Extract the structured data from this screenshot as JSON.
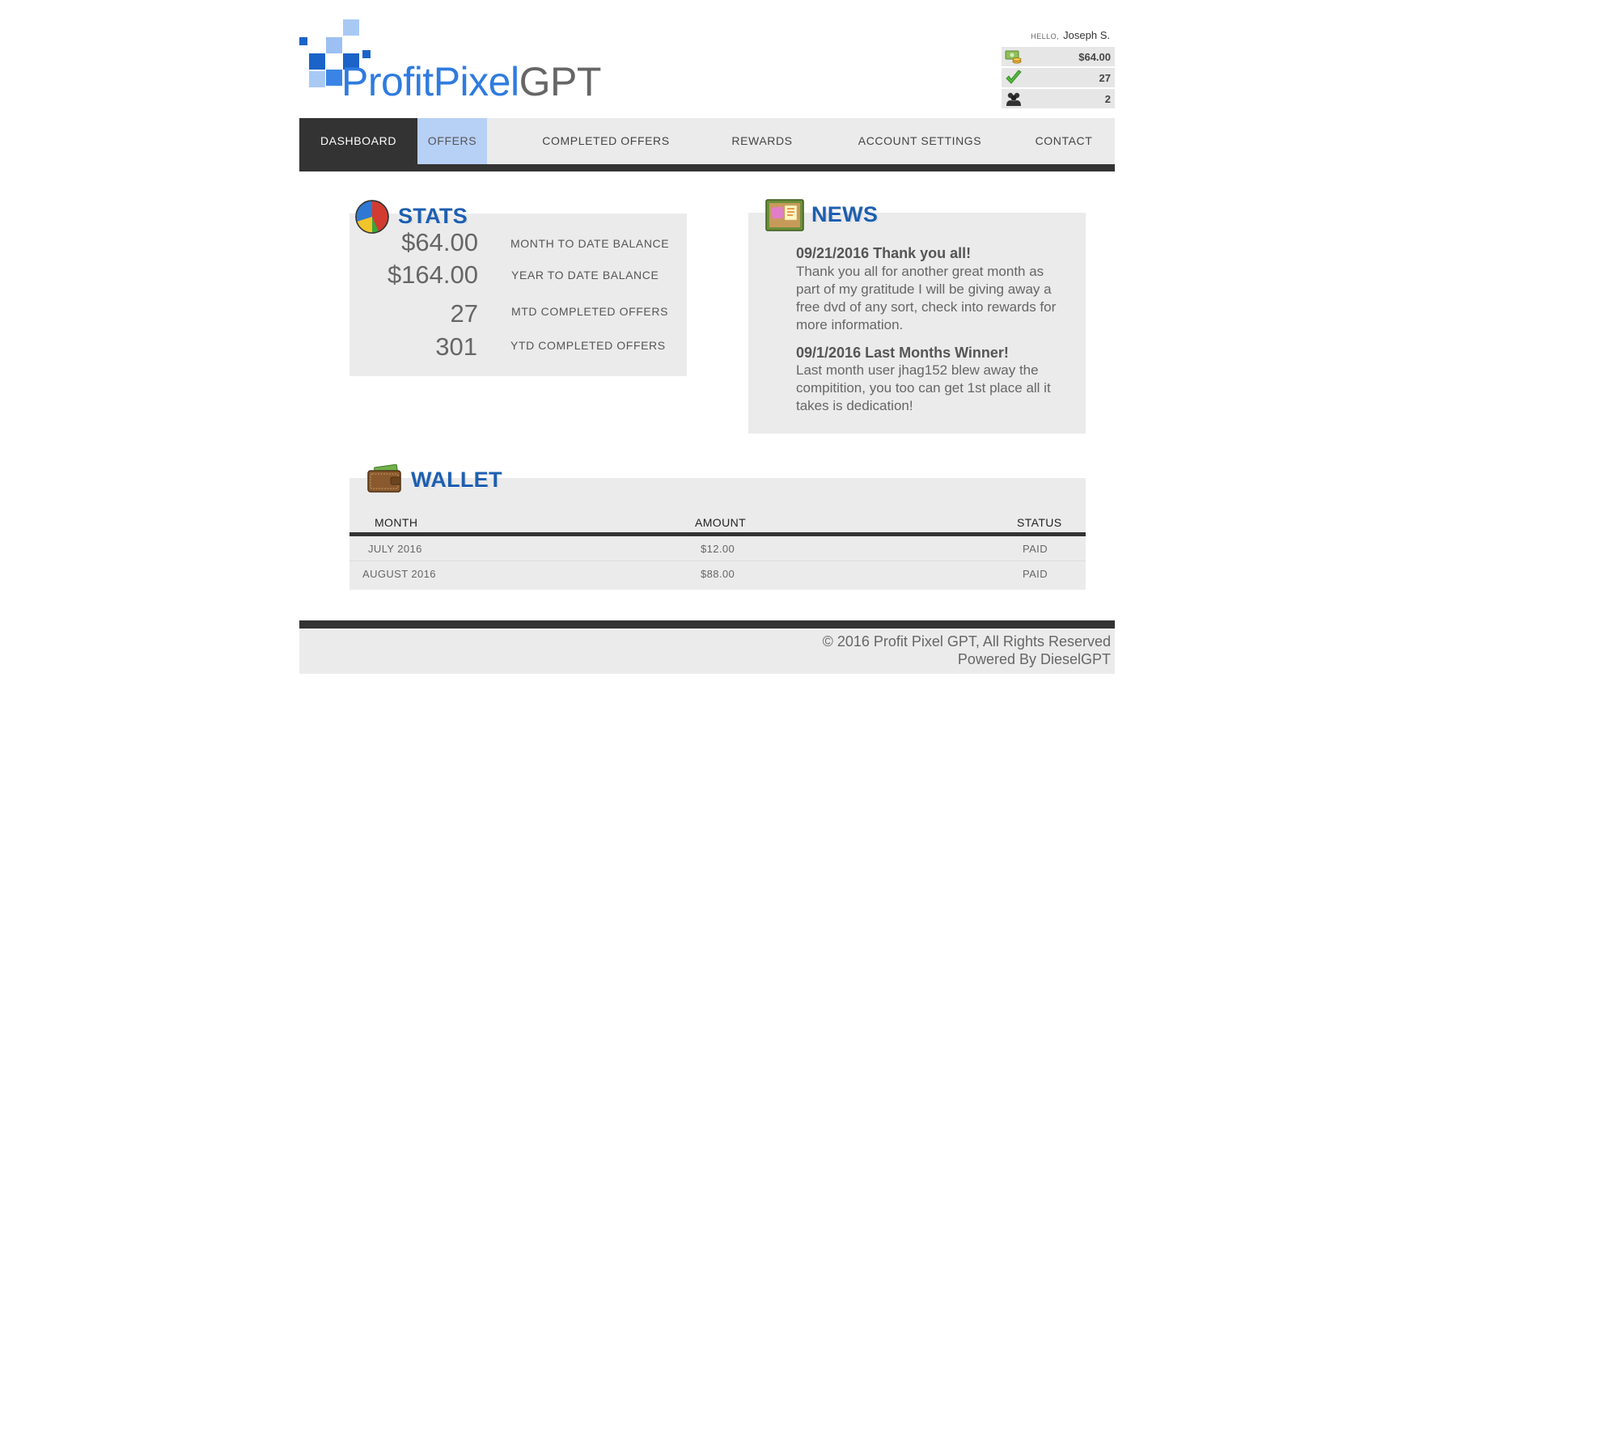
{
  "brand": {
    "name_part1": "ProfitPixel",
    "name_part2": "GPT"
  },
  "user": {
    "hello_label": "HELLO,",
    "name": "Joseph S.",
    "balance": "$64.00",
    "completed_count": "27",
    "referrals_count": "2"
  },
  "nav": {
    "items": [
      {
        "label": "DASHBOARD"
      },
      {
        "label": "OFFERS"
      },
      {
        "label": "COMPLETED OFFERS"
      },
      {
        "label": "REWARDS"
      },
      {
        "label": "ACCOUNT SETTINGS"
      },
      {
        "label": "CONTACT"
      }
    ],
    "active": "DASHBOARD",
    "hovered": "OFFERS"
  },
  "stats": {
    "title": "STATS",
    "rows": [
      {
        "value": "$64.00",
        "label": "MONTH TO DATE BALANCE"
      },
      {
        "value": "$164.00",
        "label": "YEAR TO DATE BALANCE"
      },
      {
        "value": "27",
        "label": "MTD COMPLETED OFFERS"
      },
      {
        "value": "301",
        "label": "YTD COMPLETED OFFERS"
      }
    ]
  },
  "news": {
    "title": "NEWS",
    "items": [
      {
        "headline": "09/21/2016 Thank you all!",
        "body": "Thank you all for another great month as part of my gratitude I will be giving away a free dvd of any sort, check into rewards for more information."
      },
      {
        "headline": "09/1/2016 Last Months Winner!",
        "body": "Last month user jhag152 blew away the compitition, you too can get 1st place all it takes is dedication!"
      }
    ]
  },
  "wallet": {
    "title": "WALLET",
    "columns": [
      "MONTH",
      "AMOUNT",
      "STATUS"
    ],
    "rows": [
      {
        "month": "JULY 2016",
        "amount": "$12.00",
        "status": "PAID"
      },
      {
        "month": "AUGUST 2016",
        "amount": "$88.00",
        "status": "PAID"
      }
    ]
  },
  "footer": {
    "copyright": "© 2016 Profit Pixel GPT, All Rights Reserved",
    "powered_by": "Powered By DieselGPT"
  },
  "colors": {
    "accent_blue": "#1e5fb0",
    "logo_blue": "#2f7be0",
    "nav_active_bg": "#333333",
    "nav_hover_bg": "#b7d0f6",
    "panel_bg": "#ebebeb"
  },
  "icons": {
    "balance": "money-icon",
    "completed": "checkmark-icon",
    "referrals": "users-icon",
    "stats": "pie-chart-icon",
    "news": "bulletin-board-icon",
    "wallet": "wallet-icon"
  }
}
